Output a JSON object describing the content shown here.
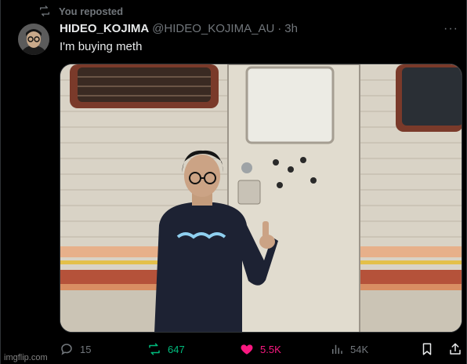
{
  "repost": {
    "label": "You reposted",
    "icon": "repost-icon"
  },
  "author": {
    "name": "HIDEO_KOJIMA",
    "handle": "@HIDEO_KOJIMA_AU",
    "separator": "·",
    "time": "3h"
  },
  "tweet": {
    "text": "I'm buying meth"
  },
  "more_icon": "more-horizontal-icon",
  "actions": {
    "reply": {
      "count": "15",
      "icon": "reply-icon"
    },
    "repost": {
      "count": "647",
      "icon": "repost-icon",
      "color": "#00ba7c"
    },
    "like": {
      "count": "5.5K",
      "icon": "heart-icon",
      "color": "#f91880"
    },
    "views": {
      "count": "54K",
      "icon": "views-icon"
    },
    "bookmark": {
      "icon": "bookmark-icon"
    },
    "share": {
      "icon": "share-icon"
    }
  },
  "watermark": "imgflip.com",
  "colors": {
    "background": "#000000",
    "text": "#e7e9ea",
    "muted": "#71767b",
    "border": "#2f3336"
  }
}
